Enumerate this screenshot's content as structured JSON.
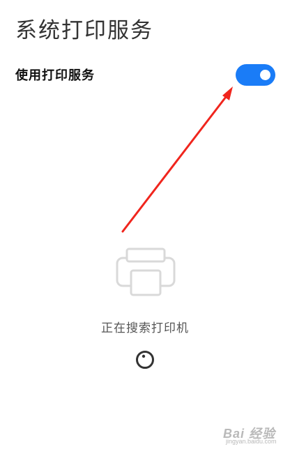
{
  "header": {
    "title": "系统打印服务"
  },
  "settings": {
    "use_print_service_label": "使用打印服务",
    "use_print_service_enabled": true
  },
  "search": {
    "status_text": "正在搜索打印机",
    "printer_icon": "printer-icon",
    "spinner_icon": "loading-spinner-icon"
  },
  "annotation": {
    "arrow_icon": "red-arrow-annotation",
    "arrow_color": "#f0251d"
  },
  "watermark": {
    "main": "Bai 经验",
    "sub": "jingyan.baidu.com"
  },
  "colors": {
    "accent": "#1a7cf7",
    "title": "#333333",
    "label": "#111111",
    "muted": "#555555",
    "icon_gray": "#d9d9d9"
  }
}
